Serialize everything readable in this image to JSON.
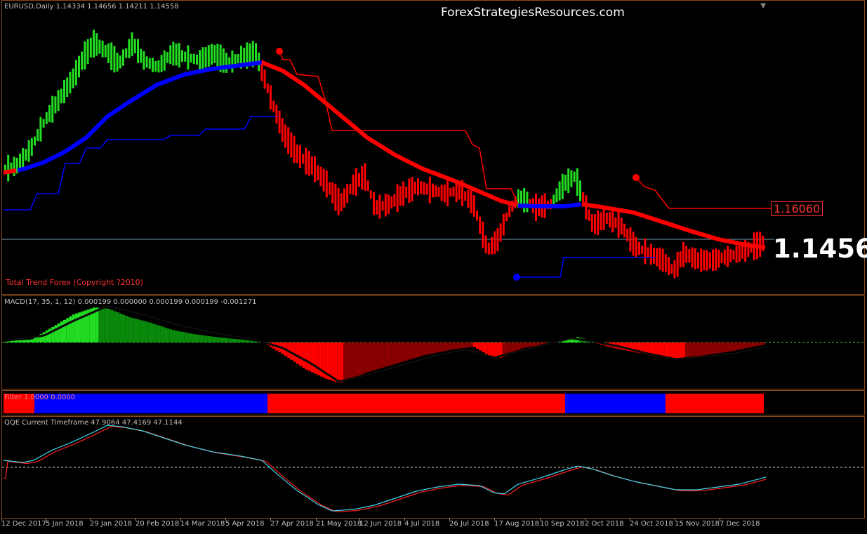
{
  "main": {
    "symbol_info": "EURUSD,Daily  1.14334 1.14656 1.14211 1.14558",
    "watermark": "ForexStrategiesResources.com",
    "indicator_label": "Total Trend Forex (Copyright ?2010)",
    "level_label": "1.16060",
    "price_label": "1.1456"
  },
  "macd": {
    "label": "MACD(17, 35, 1, 12) 0.000199 0.000000 0.000199 0.000199 -0.001271"
  },
  "filter": {
    "label": "Filter 1.0000 0.0000"
  },
  "qqe": {
    "label": "QQE Current Timeframe 47.9064 47.4169 47.1144"
  },
  "dates": [
    "12 Dec 2017",
    "5 Jan 2018",
    "29 Jan 2018",
    "20 Feb 2018",
    "14 Mar 2018",
    "5 Apr 2018",
    "27 Apr 2018",
    "21 May 2018",
    "12 Jun 2018",
    "4 Jul 2018",
    "26 Jul 2018",
    "17 Aug 2018",
    "10 Sep 2018",
    "2 Oct 2018",
    "24 Oct 2018",
    "15 Nov 2018",
    "7 Dec 2018"
  ],
  "colors": {
    "bull": "#22dd22",
    "bear": "#ff0000",
    "trend_up": "#0000ff",
    "trend_down": "#ff0000",
    "frame": "#8a4a1a"
  },
  "chart_data": {
    "type": "bar",
    "x": [
      "12 Dec 2017",
      "5 Jan 2018",
      "29 Jan 2018",
      "20 Feb 2018",
      "14 Mar 2018",
      "5 Apr 2018",
      "27 Apr 2018",
      "21 May 2018",
      "12 Jun 2018",
      "4 Jul 2018",
      "26 Jul 2018",
      "17 Aug 2018",
      "10 Sep 2018",
      "2 Oct 2018",
      "24 Oct 2018",
      "15 Nov 2018",
      "7 Dec 2018"
    ],
    "series": [
      {
        "values": [
          1.183,
          1.205,
          1.245,
          1.24,
          1.235,
          1.23,
          1.215,
          1.18,
          1.165,
          1.17,
          1.17,
          1.155,
          1.168,
          1.16,
          1.145,
          1.135,
          1.14
        ]
      }
    ]
  }
}
